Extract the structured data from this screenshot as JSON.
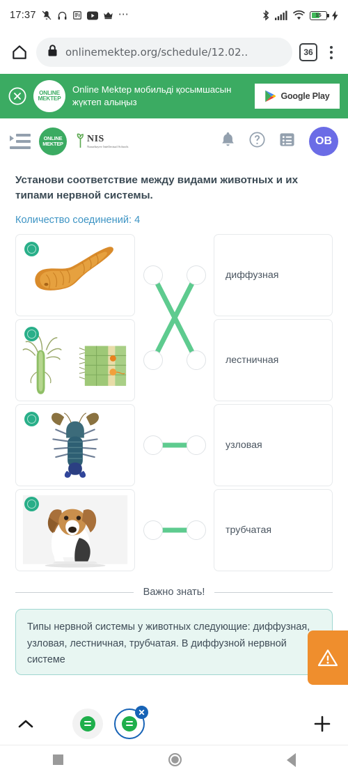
{
  "status_bar": {
    "time": "17:37",
    "left_icons": [
      "mute-icon",
      "headphones-icon",
      "news-icon",
      "youtube-icon",
      "crown-icon",
      "overflow-dots-icon"
    ],
    "right_icons": [
      "bluetooth-icon",
      "cellular-signal-icon",
      "wifi-icon"
    ],
    "battery_level": "15",
    "charging": true
  },
  "browser": {
    "url": "onlinemektep.org/schedule/12.02..",
    "tab_count": "36",
    "secure": true
  },
  "promo": {
    "logo_line1": "ONLINE",
    "logo_line2": "MEKTEP",
    "text": "Online Mektep мобильді қосымшасын жүктеп алыңыз",
    "store_badge": "Google Play"
  },
  "site_header": {
    "logo_line1": "ONLINE",
    "logo_line2": "MEKTEP",
    "nis_name": "NIS",
    "nis_sub": "Nazarbayev Intellectual Schools",
    "avatar_initials": "ОВ",
    "icons": [
      "menu-icon",
      "bell-icon",
      "help-icon",
      "list-icon"
    ]
  },
  "task": {
    "title": "Установи соответствие между видами животных и их типами нервной системы.",
    "connections_label": "Количество соединений: 4",
    "accent_color": "#3d94c4",
    "link_color": "#5ecb8f",
    "left_items": [
      {
        "art": "flatworm-planaria",
        "alt": "плоский червь"
      },
      {
        "art": "hydra-diagram",
        "alt": "гидра"
      },
      {
        "art": "crayfish",
        "alt": "рак"
      },
      {
        "art": "dog-beagle",
        "alt": "собака"
      }
    ],
    "right_items": [
      {
        "label": "диффузная"
      },
      {
        "label": "лестничная"
      },
      {
        "label": "узловая"
      },
      {
        "label": "трубчатая"
      }
    ],
    "connections": [
      {
        "from": 0,
        "to": 1
      },
      {
        "from": 1,
        "to": 0
      },
      {
        "from": 2,
        "to": 2
      },
      {
        "from": 3,
        "to": 3
      }
    ]
  },
  "important": {
    "heading": "Важно знать!",
    "body": "Типы нервной системы у животных следующие: диффузная, узловая, лестничная, трубчатая. В диффузной нервной системе"
  },
  "warn_button": {
    "icon": "warning-triangle-icon"
  },
  "bottom_bar": {
    "collapse_icon": "chevron-up-icon",
    "tabs": [
      {
        "favicon": "onlinemektep-favicon",
        "active": false
      },
      {
        "favicon": "onlinemektep-favicon",
        "active": true,
        "close_icon": "close-icon"
      }
    ],
    "new_tab_icon": "plus-icon"
  },
  "nav_bar": {
    "buttons": [
      "recents-button",
      "home-button",
      "back-button"
    ]
  }
}
